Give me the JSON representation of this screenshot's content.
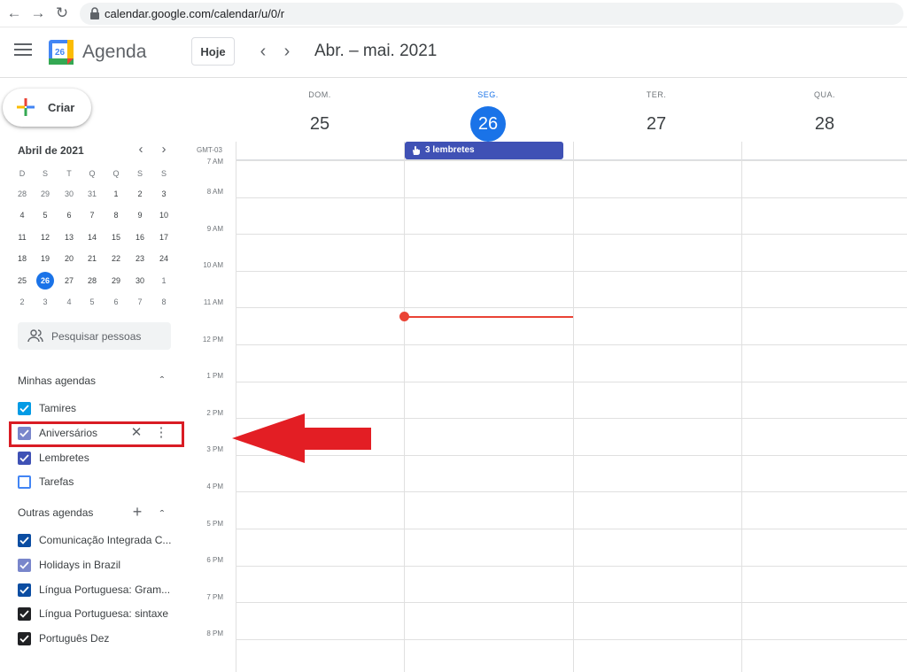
{
  "browser": {
    "url": "calendar.google.com/calendar/u/0/r",
    "back_icon": "arrow-left-icon",
    "forward_icon": "arrow-right-icon",
    "reload_icon": "reload-icon",
    "lock_icon": "lock-icon"
  },
  "header": {
    "logo_day": "26",
    "app_name": "Agenda",
    "today_label": "Hoje",
    "period": "Abr. – mai. 2021"
  },
  "sidebar": {
    "create_label": "Criar",
    "mini_calendar": {
      "title": "Abril de 2021",
      "weekdays": [
        "D",
        "S",
        "T",
        "Q",
        "Q",
        "S",
        "S"
      ],
      "weeks": [
        [
          "28",
          "29",
          "30",
          "31",
          "1",
          "2",
          "3"
        ],
        [
          "4",
          "5",
          "6",
          "7",
          "8",
          "9",
          "10"
        ],
        [
          "11",
          "12",
          "13",
          "14",
          "15",
          "16",
          "17"
        ],
        [
          "18",
          "19",
          "20",
          "21",
          "22",
          "23",
          "24"
        ],
        [
          "25",
          "26",
          "27",
          "28",
          "29",
          "30",
          "1"
        ],
        [
          "2",
          "3",
          "4",
          "5",
          "6",
          "7",
          "8"
        ]
      ],
      "selected": "26"
    },
    "search_people": "Pesquisar pessoas",
    "my_calendars_title": "Minhas agendas",
    "my_calendars": [
      {
        "label": "Tamires",
        "color": "#039be5",
        "checked": true
      },
      {
        "label": "Aniversários",
        "color": "#7986cb",
        "checked": true
      },
      {
        "label": "Lembretes",
        "color": "#3f51b5",
        "checked": true
      },
      {
        "label": "Tarefas",
        "color": "#4285f4",
        "checked": false
      }
    ],
    "other_calendars_title": "Outras agendas",
    "other_calendars": [
      {
        "label": "Comunicação Integrada C...",
        "color": "#0b4da2",
        "checked": true
      },
      {
        "label": "Holidays in Brazil",
        "color": "#7986cb",
        "checked": true
      },
      {
        "label": "Língua Portuguesa: Gram...",
        "color": "#0b4da2",
        "checked": true
      },
      {
        "label": "Língua Portuguesa: sintaxe",
        "color": "#202124",
        "checked": true
      },
      {
        "label": "Português Dez",
        "color": "#202124",
        "checked": true
      }
    ]
  },
  "days": [
    {
      "dow": "DOM.",
      "num": "25",
      "today": false
    },
    {
      "dow": "SEG.",
      "num": "26",
      "today": true
    },
    {
      "dow": "TER.",
      "num": "27",
      "today": false
    },
    {
      "dow": "QUA.",
      "num": "28",
      "today": false
    }
  ],
  "timezone": "GMT-03",
  "reminder_chip": "3 lembretes",
  "hours": [
    "7 AM",
    "8 AM",
    "9 AM",
    "10 AM",
    "11 AM",
    "12 PM",
    "1 PM",
    "2 PM",
    "3 PM",
    "4 PM",
    "5 PM",
    "6 PM",
    "7 PM",
    "8 PM"
  ],
  "colors": {
    "accent": "#1a73e8",
    "now_indicator": "#ea4335",
    "annotation": "#d91c24",
    "reminder": "#3f51b5"
  }
}
